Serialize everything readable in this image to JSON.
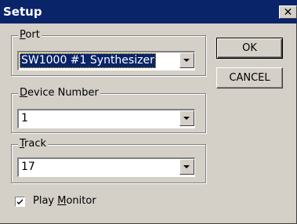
{
  "window": {
    "title": "Setup",
    "close_glyph": "✕"
  },
  "port": {
    "label_accel": "P",
    "label_rest": "ort",
    "value": "SW1000 #1 Synthesizer"
  },
  "device_number": {
    "label_accel": "D",
    "label_rest": "evice Number",
    "value": "1"
  },
  "track": {
    "label_accel": "T",
    "label_rest": "rack",
    "value": "17"
  },
  "buttons": {
    "ok_label": "OK",
    "cancel_label": "CANCEL"
  },
  "play_monitor": {
    "label_pre": "Play ",
    "label_accel": "M",
    "label_rest": "onitor",
    "checked": true
  },
  "icons": {
    "dropdown": "chevron-down-icon",
    "close": "close-icon",
    "check": "check-icon"
  }
}
